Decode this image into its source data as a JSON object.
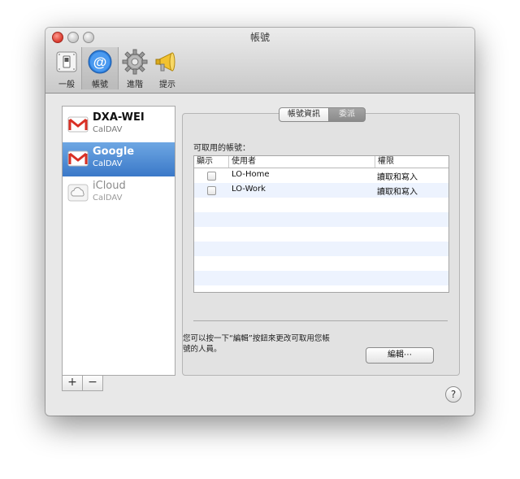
{
  "window": {
    "title": "帳號"
  },
  "toolbar": {
    "items": [
      {
        "label": "一般",
        "icon": "switch-icon"
      },
      {
        "label": "帳號",
        "icon": "at-sign-icon",
        "selected": true
      },
      {
        "label": "進階",
        "icon": "gear-icon"
      },
      {
        "label": "提示",
        "icon": "megaphone-icon"
      }
    ]
  },
  "sidebar": {
    "accounts": [
      {
        "name": "DXA-WEI",
        "type": "CalDAV",
        "icon": "gmail-icon"
      },
      {
        "name": "Google",
        "type": "CalDAV",
        "icon": "gmail-icon",
        "selected": true
      },
      {
        "name": "iCloud",
        "type": "CalDAV",
        "icon": "cloud-icon",
        "disabled": true
      }
    ],
    "add_label": "+",
    "remove_label": "−"
  },
  "panel": {
    "tabs": [
      {
        "label": "帳號資訊"
      },
      {
        "label": "委派",
        "selected": true
      }
    ],
    "available_label": "可取用的帳號：",
    "table": {
      "headers": {
        "show": "顯示",
        "user": "使用者",
        "permission": "權限"
      },
      "rows": [
        {
          "user": "LO-Home",
          "permission": "讀取和寫入",
          "checked": false
        },
        {
          "user": "LO-Work",
          "permission": "讀取和寫入",
          "checked": false
        }
      ]
    },
    "hint_line1": "您可以按一下“編輯”按鈕來更改可取用您帳",
    "hint_line2": "號的人員。",
    "edit_label": "編輯⋯"
  },
  "help_label": "?"
}
